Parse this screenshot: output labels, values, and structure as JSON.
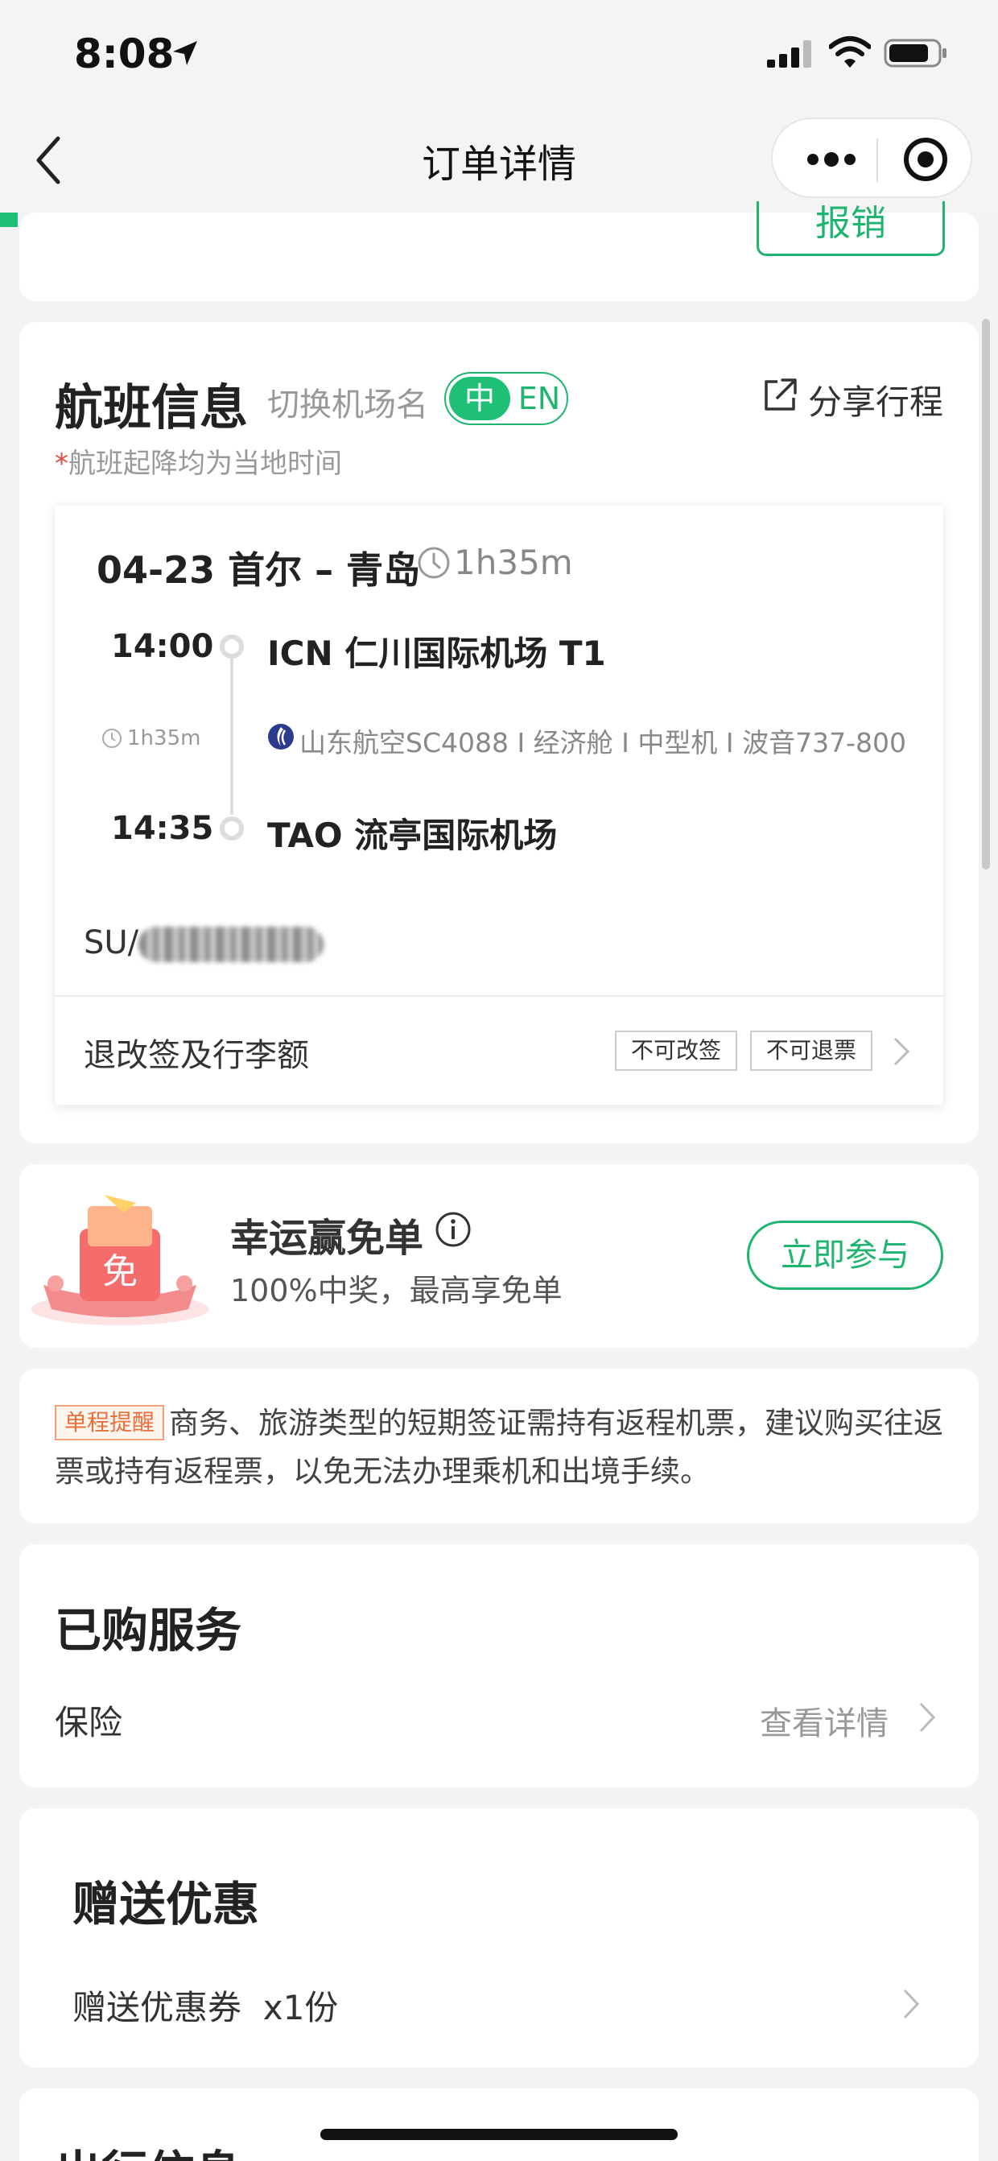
{
  "status_bar": {
    "time": "8:08"
  },
  "nav": {
    "title": "订单详情"
  },
  "top_card": {
    "reimburse_label": "报销"
  },
  "flight_info": {
    "title": "航班信息",
    "switch_label": "切换机场名",
    "lang_zh": "中",
    "lang_en": "EN",
    "share_label": "分享行程",
    "note_star": "*",
    "note_text": "航班起降均为当地时间",
    "route": "04-23 首尔 – 青岛",
    "route_duration": "1h35m",
    "departure_time": "14:00",
    "departure_airport": "ICN 仁川国际机场 T1",
    "mid_duration": "1h35m",
    "flight_detail": "山东航空SC4088 I 经济舱 I 中型机 I 波音737-800",
    "arrival_time": "14:35",
    "arrival_airport": "TAO 流亭国际机场",
    "passenger_prefix": "SU/",
    "rules_label": "退改签及行李额",
    "tag_no_change": "不可改签",
    "tag_no_refund": "不可退票"
  },
  "lucky": {
    "badge": "免",
    "title": "幸运赢免单",
    "subtitle": "100%中奖，最高享免单",
    "join_label": "立即参与"
  },
  "reminder": {
    "tag": "单程提醒",
    "text": "商务、旅游类型的短期签证需持有返程机票，建议购买往返票或持有返程票，以免无法办理乘机和出境手续。"
  },
  "purchased": {
    "title": "已购服务",
    "insurance_label": "保险",
    "insurance_link": "查看详情"
  },
  "gift": {
    "title": "赠送优惠",
    "coupon_label": "赠送优惠券",
    "coupon_count": "x1份"
  },
  "travel": {
    "title": "出行信息"
  },
  "colors": {
    "brand_green": "#1fb46f",
    "reminder_orange": "#e8703a"
  }
}
